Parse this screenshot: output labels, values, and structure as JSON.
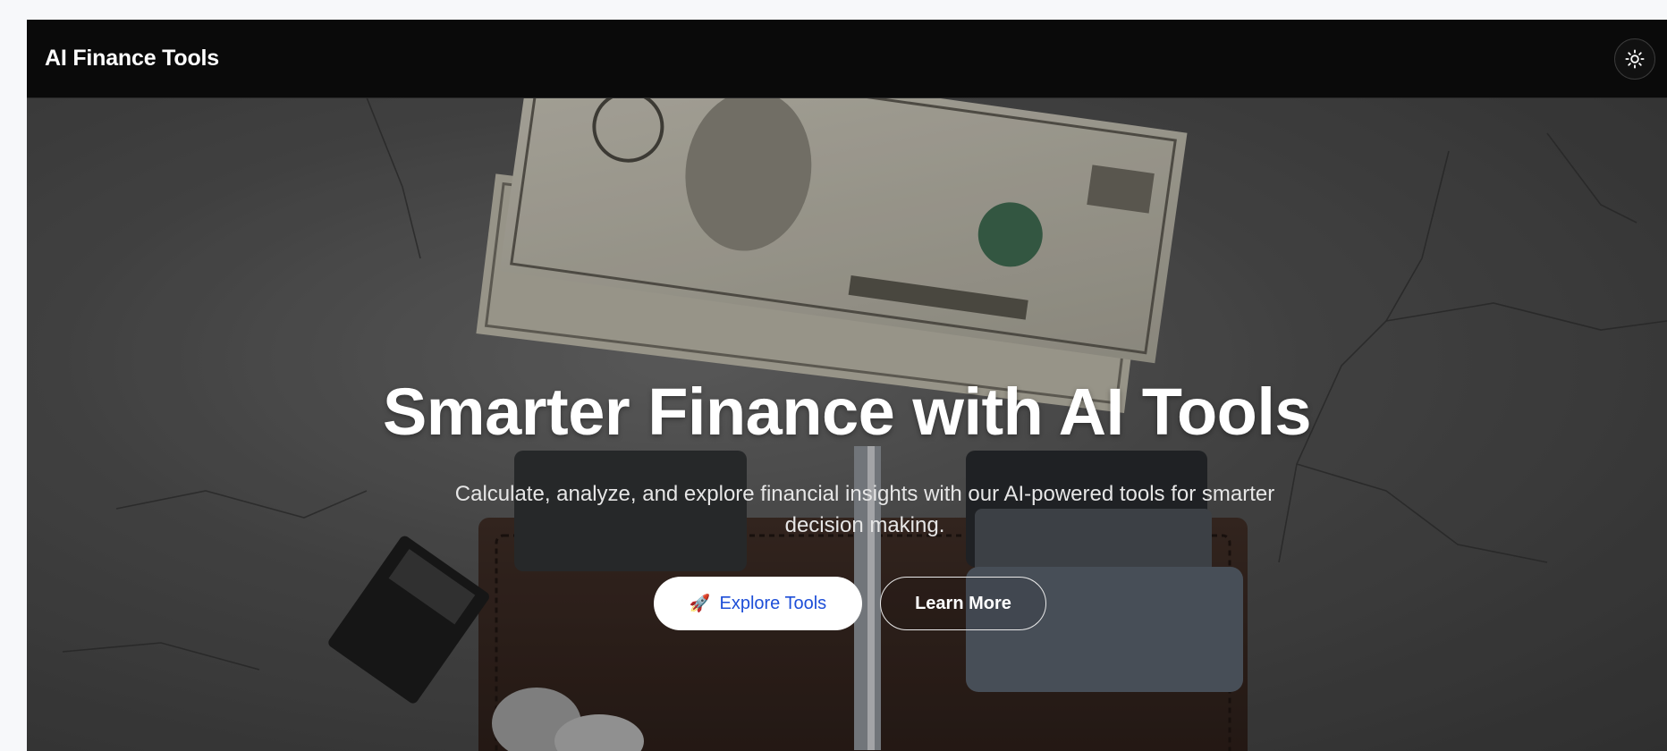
{
  "header": {
    "brand": "AI Finance Tools",
    "theme_toggle_icon": "sun-icon"
  },
  "hero": {
    "title": "Smarter Finance with AI Tools",
    "subtitle": "Calculate, analyze, and explore financial insights with our AI-powered tools for smarter decision making.",
    "primary_button": {
      "icon": "rocket-icon",
      "icon_glyph": "🚀",
      "label": "Explore Tools"
    },
    "secondary_button": {
      "label": "Learn More"
    }
  },
  "colors": {
    "navbar_bg": "#0a0a0a",
    "primary_button_text": "#1d4ed8",
    "primary_button_bg": "#ffffff"
  }
}
